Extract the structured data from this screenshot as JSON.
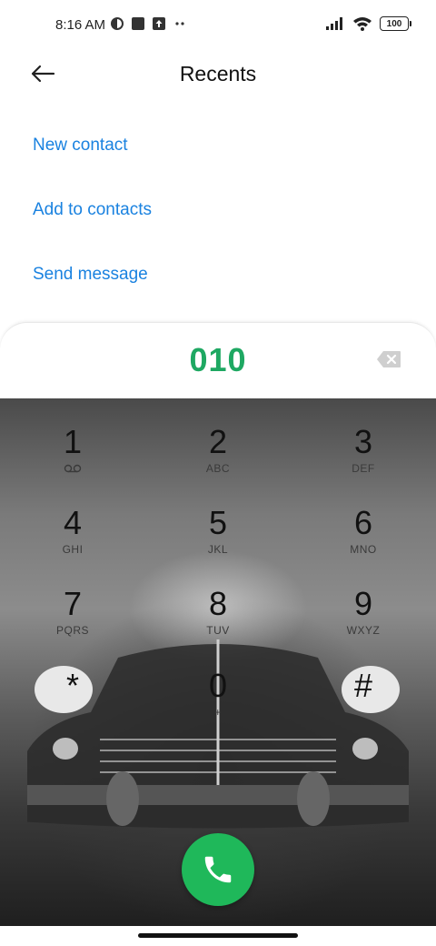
{
  "status_bar": {
    "time": "8:16 AM",
    "battery": "100",
    "icons": [
      "notification-icon",
      "square-icon",
      "upload-icon",
      "more-dots-icon",
      "signal-icon",
      "wifi-icon",
      "battery-icon"
    ]
  },
  "header": {
    "title": "Recents",
    "back_icon": "back-arrow-icon"
  },
  "actions": [
    {
      "label": "New contact"
    },
    {
      "label": "Add to contacts"
    },
    {
      "label": "Send message"
    }
  ],
  "dialer": {
    "number": "010",
    "number_color": "#1ea862",
    "backspace_icon": "backspace-icon"
  },
  "keypad": [
    {
      "digit": "1",
      "letters": ""
    },
    {
      "digit": "2",
      "letters": "ABC"
    },
    {
      "digit": "3",
      "letters": "DEF"
    },
    {
      "digit": "4",
      "letters": "GHI"
    },
    {
      "digit": "5",
      "letters": "JKL"
    },
    {
      "digit": "6",
      "letters": "MNO"
    },
    {
      "digit": "7",
      "letters": "PQRS"
    },
    {
      "digit": "8",
      "letters": "TUV"
    },
    {
      "digit": "9",
      "letters": "WXYZ"
    },
    {
      "digit": "*",
      "letters": ""
    },
    {
      "digit": "0",
      "letters": "+"
    },
    {
      "digit": "#",
      "letters": ""
    }
  ],
  "call_button": {
    "icon": "phone-icon",
    "color": "#1fb85a"
  },
  "colors": {
    "link": "#1a82e0"
  }
}
